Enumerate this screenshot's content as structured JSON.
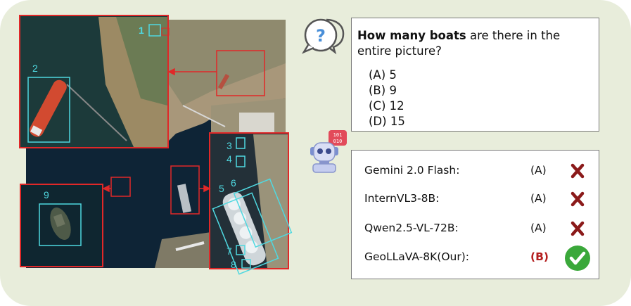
{
  "question": {
    "bold": "How many boats",
    "rest": "are there in the entire picture?",
    "options": [
      "(A) 5",
      "(B) 9",
      "(C) 12",
      "(D) 15"
    ]
  },
  "results": [
    {
      "model": "Gemini 2.0 Flash:",
      "answer": "(A)",
      "correct": false
    },
    {
      "model": "InternVL3-8B:",
      "answer": "(A)",
      "correct": false
    },
    {
      "model": "Qwen2.5-VL-72B:",
      "answer": "(A)",
      "correct": false
    },
    {
      "model": "GeoLLaVA-8K(Our):",
      "answer": "(B)",
      "correct": true
    }
  ],
  "boat_labels": [
    "1",
    "2",
    "3",
    "4",
    "5",
    "6",
    "7",
    "8",
    "9"
  ],
  "robot_badge": {
    "line1": "101",
    "line2": "010"
  },
  "question_icon": "?",
  "colors": {
    "panel": "#e8eddb",
    "zoom_box": "#e02828",
    "boat_box": "#4fd8e0",
    "wrong": "#8b1a1a",
    "correct": "#3aa83a",
    "water": "#0e2436",
    "land": "#b8a582"
  }
}
